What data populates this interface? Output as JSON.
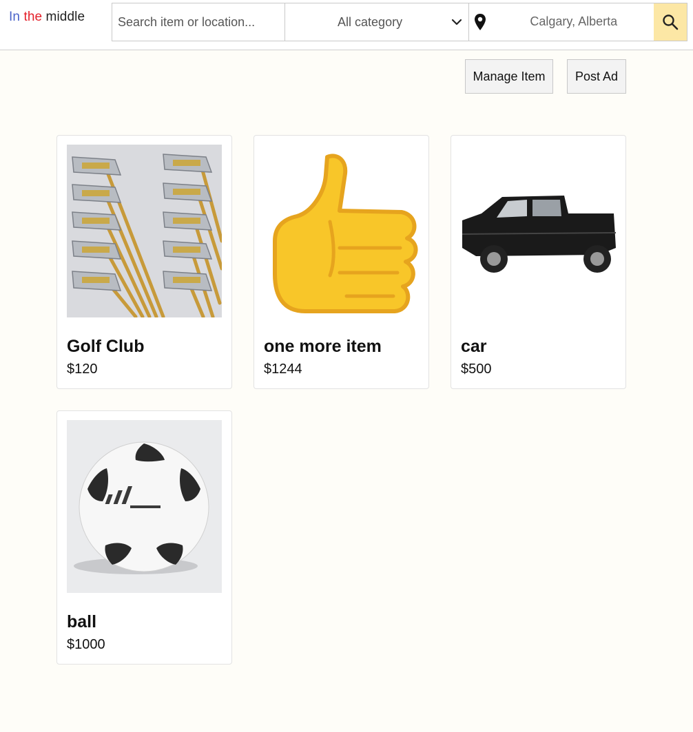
{
  "header": {
    "logo": {
      "word1": "In",
      "word2": "the",
      "word3": "middle"
    },
    "search": {
      "placeholder": "Search item or location..."
    },
    "category": {
      "selected": "All category"
    },
    "location": {
      "value": "Calgary, Alberta"
    },
    "icons": {
      "search": "search-icon",
      "chevron": "chevron-down-icon",
      "pin": "location-pin-icon"
    }
  },
  "actions": {
    "manage_label": "Manage Item",
    "post_label": "Post Ad"
  },
  "items": [
    {
      "title": "Golf Club",
      "price": "$120",
      "image": "golf-clubs-photo"
    },
    {
      "title": "one more item",
      "price": "$1244",
      "image": "thumbs-up-emoji"
    },
    {
      "title": "car",
      "price": "$500",
      "image": "pickup-truck-photo"
    },
    {
      "title": "ball",
      "price": "$1000",
      "image": "soccer-ball-photo"
    }
  ],
  "colors": {
    "logo_in": "#4a63c9",
    "logo_the": "#e4202a",
    "search_button": "#fce7a5",
    "page_bg": "#fefdf8"
  }
}
